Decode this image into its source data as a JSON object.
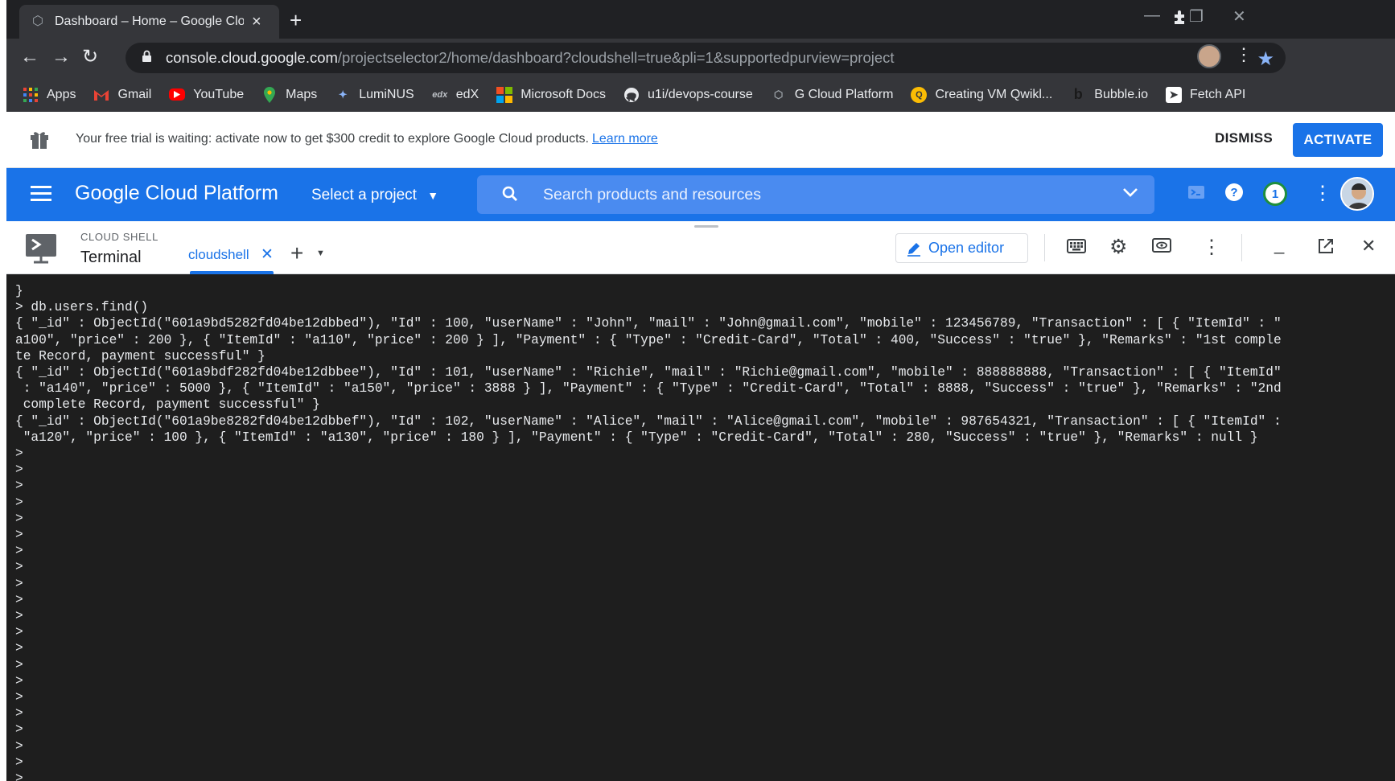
{
  "browser": {
    "tab_title": "Dashboard – Home – Google Clo",
    "tab_favicon": "gcp-favicon-icon",
    "url_host": "console.cloud.google.com",
    "url_path": "/projectselector2/home/dashboard?cloudshell=true&pli=1&supportedpurview=project",
    "bookmarks": [
      {
        "label": "Apps",
        "icon": "apps-grid-icon"
      },
      {
        "label": "Gmail",
        "icon": "gmail-icon"
      },
      {
        "label": "YouTube",
        "icon": "youtube-icon"
      },
      {
        "label": "Maps",
        "icon": "maps-icon"
      },
      {
        "label": "LumiNUS",
        "icon": "luminus-icon"
      },
      {
        "label": "edX",
        "icon": "edx-icon"
      },
      {
        "label": "Microsoft Docs",
        "icon": "microsoft-icon"
      },
      {
        "label": "u1i/devops-course",
        "icon": "github-icon"
      },
      {
        "label": "G Cloud Platform",
        "icon": "gcp-icon"
      },
      {
        "label": "Creating VM Qwikl...",
        "icon": "qwiklabs-icon"
      },
      {
        "label": "Bubble.io",
        "icon": "bubble-icon"
      },
      {
        "label": "Fetch API",
        "icon": "fetch-icon"
      }
    ]
  },
  "banner": {
    "text": "Your free trial is waiting: activate now to get $300 credit to explore Google Cloud products.",
    "link": "Learn more",
    "dismiss": "DISMISS",
    "activate": "ACTIVATE"
  },
  "header": {
    "title": "Google Cloud Platform",
    "project": "Select a project",
    "search_placeholder": "Search products and resources",
    "notification_count": "1"
  },
  "shell": {
    "section_label": "CLOUD SHELL",
    "title": "Terminal",
    "tab_label": "cloudshell",
    "open_editor": "Open editor"
  },
  "terminal": {
    "lines": [
      "}",
      "> db.users.find()",
      "{ \"_id\" : ObjectId(\"601a9bd5282fd04be12dbbed\"), \"Id\" : 100, \"userName\" : \"John\", \"mail\" : \"John@gmail.com\", \"mobile\" : 123456789, \"Transaction\" : [ { \"ItemId\" : \"",
      "a100\", \"price\" : 200 }, { \"ItemId\" : \"a110\", \"price\" : 200 } ], \"Payment\" : { \"Type\" : \"Credit-Card\", \"Total\" : 400, \"Success\" : \"true\" }, \"Remarks\" : \"1st comple",
      "te Record, payment successful\" }",
      "{ \"_id\" : ObjectId(\"601a9bdf282fd04be12dbbee\"), \"Id\" : 101, \"userName\" : \"Richie\", \"mail\" : \"Richie@gmail.com\", \"mobile\" : 888888888, \"Transaction\" : [ { \"ItemId\"",
      " : \"a140\", \"price\" : 5000 }, { \"ItemId\" : \"a150\", \"price\" : 3888 } ], \"Payment\" : { \"Type\" : \"Credit-Card\", \"Total\" : 8888, \"Success\" : \"true\" }, \"Remarks\" : \"2nd",
      " complete Record, payment successful\" }",
      "{ \"_id\" : ObjectId(\"601a9be8282fd04be12dbbef\"), \"Id\" : 102, \"userName\" : \"Alice\", \"mail\" : \"Alice@gmail.com\", \"mobile\" : 987654321, \"Transaction\" : [ { \"ItemId\" :",
      " \"a120\", \"price\" : 100 }, { \"ItemId\" : \"a130\", \"price\" : 180 } ], \"Payment\" : { \"Type\" : \"Credit-Card\", \"Total\" : 280, \"Success\" : \"true\" }, \"Remarks\" : null }",
      ">",
      ">",
      ">",
      ">",
      ">",
      ">",
      ">",
      ">",
      ">",
      ">",
      ">",
      ">",
      ">",
      ">",
      ">",
      ">",
      ">",
      ">",
      ">",
      ">",
      ">"
    ]
  },
  "colors": {
    "gcp_blue": "#1a73e8",
    "terminal_bg": "#1e1e1e",
    "chrome_toolbar": "#35363a",
    "chrome_tabstrip": "#202124"
  }
}
